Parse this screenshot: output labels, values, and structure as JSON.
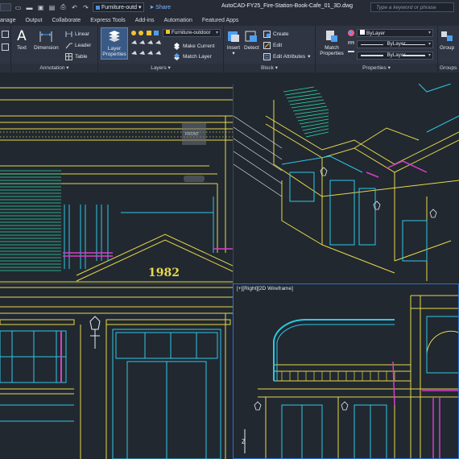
{
  "titlebar": {
    "workspace_value": "Furniture-outd",
    "share_label": "Share",
    "document_title": "AutoCAD-FY25_Fire-Station-Book-Cafe_01_3D.dwg",
    "search_placeholder": "Type a keyword or phrase"
  },
  "tabs": [
    "anage",
    "Output",
    "Collaborate",
    "Express Tools",
    "Add-ins",
    "Automation",
    "Featured Apps"
  ],
  "ribbon": {
    "annotation": {
      "title": "Annotation",
      "text_label": "Text",
      "dimension_label": "Dimension",
      "linear_label": "Linear",
      "leader_label": "Leader",
      "table_label": "Table"
    },
    "layers": {
      "title": "Layers",
      "layer_properties_label": "Layer\nProperties",
      "layer_dropdown": "Furniture-outdoor",
      "make_current_label": "Make Current",
      "match_layer_label": "Match Layer"
    },
    "block": {
      "title": "Block",
      "insert_label": "Insert",
      "detect_label": "Detect",
      "create_label": "Create",
      "edit_label": "Edit",
      "edit_attributes_label": "Edit Attributes"
    },
    "properties": {
      "title": "Properties",
      "match_properties_label": "Match\nProperties",
      "color_value": "ByLayer",
      "linetype_value": "ByLayer",
      "lineweight_value": "ByLayer"
    },
    "groups": {
      "title": "Groups",
      "group_label": "Group"
    }
  },
  "drawing": {
    "front_elevation_year": "1982",
    "viewcube_face": "FRONT",
    "right_viewport_label": "[+][Right][2D Wireframe]",
    "ucs_axis_label": "Z"
  },
  "colors": {
    "canvas": "#212830",
    "yellow": "#e8d84a",
    "cyan": "#2ec8e6",
    "magenta": "#d83ec8",
    "green": "#2ed6a8",
    "white": "#e8ecf0",
    "active_viewport": "#2f6fd0"
  }
}
